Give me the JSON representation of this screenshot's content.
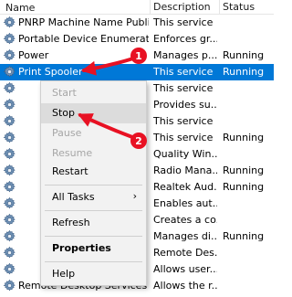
{
  "header": {
    "name": "Name",
    "description": "Description",
    "status": "Status"
  },
  "services": [
    {
      "name": "PNRP Machine Name Publi...",
      "description": "This service ...",
      "status": ""
    },
    {
      "name": "Portable Device Enumerator...",
      "description": "Enforces gr...",
      "status": ""
    },
    {
      "name": "Power",
      "description": "Manages p...",
      "status": "Running"
    },
    {
      "name": "Print Spooler",
      "description": "This service ...",
      "status": "Running",
      "selected": true
    },
    {
      "name": "",
      "description": "This service ...",
      "status": ""
    },
    {
      "name": "",
      "description": "Provides su...",
      "status": ""
    },
    {
      "name": "",
      "description": "This service ...",
      "status": ""
    },
    {
      "name": "",
      "description": "This service ...",
      "status": "Running"
    },
    {
      "name": "",
      "description": "Quality Win...",
      "status": ""
    },
    {
      "name": "",
      "description": "Radio Mana...",
      "status": "Running"
    },
    {
      "name": "",
      "description": "Realtek Aud...",
      "status": "Running"
    },
    {
      "name": "",
      "description": "Enables aut...",
      "status": ""
    },
    {
      "name": "",
      "description": "Creates a co...",
      "status": ""
    },
    {
      "name": "",
      "description": "Manages di...",
      "status": "Running"
    },
    {
      "name": "",
      "description": "Remote Des...",
      "status": ""
    },
    {
      "name": "",
      "description": "Allows user...",
      "status": ""
    },
    {
      "name": "Remote Desktop Services U...",
      "description": "Allows the r...",
      "status": ""
    }
  ],
  "context_menu": {
    "start": "Start",
    "stop": "Stop",
    "pause": "Pause",
    "resume": "Resume",
    "restart": "Restart",
    "all_tasks": "All Tasks",
    "refresh": "Refresh",
    "properties": "Properties",
    "help": "Help"
  },
  "annotations": {
    "step1": "1",
    "step2": "2",
    "color": "#e81123"
  },
  "icons": {
    "service": "gear-icon",
    "submenu": "chevron-right-icon"
  },
  "colors": {
    "selection": "#0078d7",
    "menu_bg": "#f2f2f2",
    "disabled_text": "#a6a6a6"
  }
}
